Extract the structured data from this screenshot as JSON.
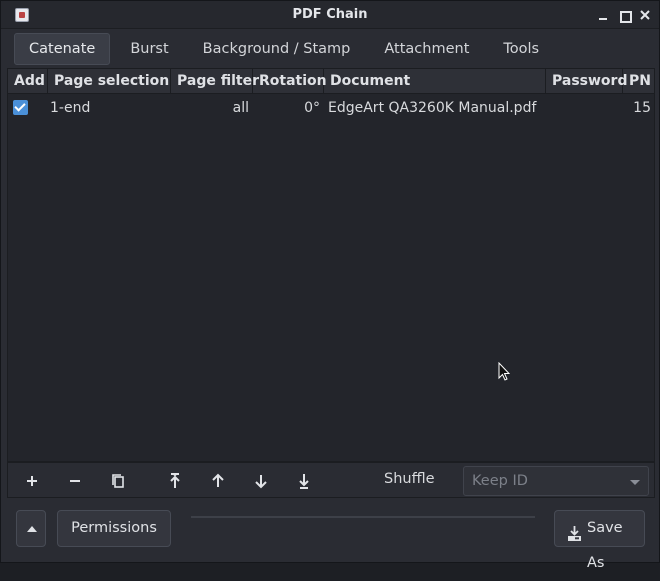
{
  "window": {
    "title": "PDF Chain"
  },
  "tabs": [
    {
      "label": "Catenate",
      "active": true
    },
    {
      "label": "Burst",
      "active": false
    },
    {
      "label": "Background / Stamp",
      "active": false
    },
    {
      "label": "Attachment",
      "active": false
    },
    {
      "label": "Tools",
      "active": false
    }
  ],
  "table": {
    "columns": [
      "Add",
      "Page selection",
      "Page filter",
      "Rotation",
      "Document",
      "Password",
      "PN"
    ],
    "rows": [
      {
        "add": true,
        "page_selection": "1-end",
        "page_filter": "all",
        "rotation": "0°",
        "document": "EdgeArt QA3260K Manual.pdf",
        "password": "",
        "pn": "15"
      }
    ]
  },
  "toolbar": {
    "icons": [
      "add-icon",
      "remove-icon",
      "copy-icon",
      "move-top-icon",
      "move-up-icon",
      "move-down-icon",
      "move-bottom-icon"
    ],
    "shuffle_label": "Shuffle",
    "id_combo": {
      "selected": "Keep ID",
      "enabled": false
    }
  },
  "footer": {
    "permissions_label": "Permissions",
    "save_as_label": "Save As",
    "progress": 0
  },
  "colors": {
    "accent": "#4a90d9",
    "background": "#2a2c33",
    "table_background": "#23252b"
  }
}
